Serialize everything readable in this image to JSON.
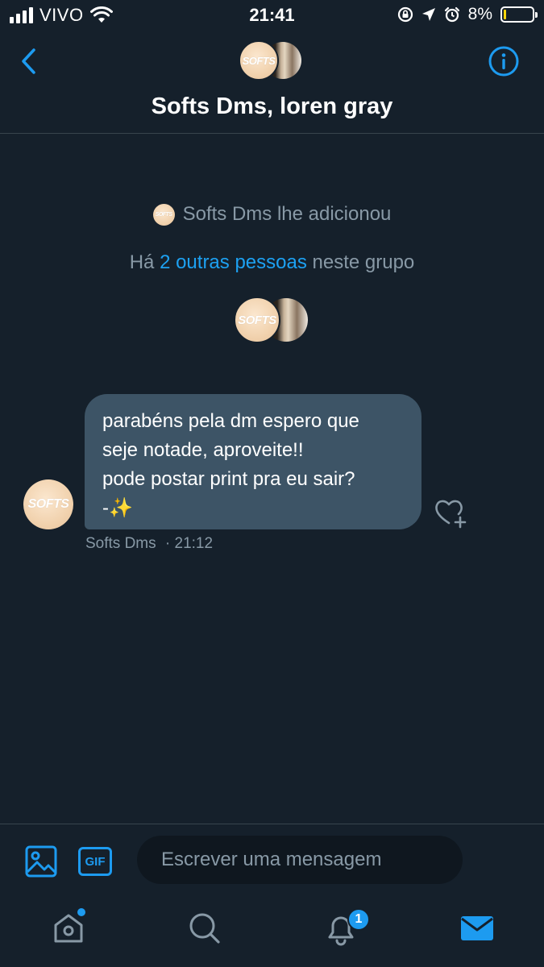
{
  "status_bar": {
    "carrier": "VIVO",
    "time": "21:41",
    "battery_percent": "8%",
    "battery_level": 0.08,
    "battery_color": "#ffd60a",
    "icons": [
      "signal-icon",
      "wifi-icon",
      "orientation-lock-icon",
      "location-icon",
      "alarm-icon",
      "battery-icon"
    ]
  },
  "header": {
    "title": "Softs Dms, loren gray",
    "back_icon": "chevron-left-icon",
    "info_icon": "info-icon",
    "avatar_softs_text": "SOFTS"
  },
  "system": {
    "added_text": "Softs Dms lhe adicionou",
    "group_prefix": "Há",
    "group_link": "2 outras pessoas",
    "group_suffix": "neste grupo"
  },
  "messages": [
    {
      "sender": "Softs Dms",
      "time": "· 21:12",
      "lines": [
        "parabéns pela dm espero que",
        "seje notade, aproveite!!",
        "pode postar print pra eu sair?",
        "-✨"
      ]
    }
  ],
  "composer": {
    "placeholder": "Escrever uma mensagem",
    "gif_label": "GIF"
  },
  "tabbar": {
    "items": [
      "home-icon",
      "search-icon",
      "notifications-icon",
      "messages-icon"
    ],
    "notification_count": "1"
  },
  "colors": {
    "background": "#15202b",
    "accent": "#1d9bf0",
    "bubble": "#3d5466",
    "muted": "#8899a6",
    "voice": "#9b5de5"
  }
}
